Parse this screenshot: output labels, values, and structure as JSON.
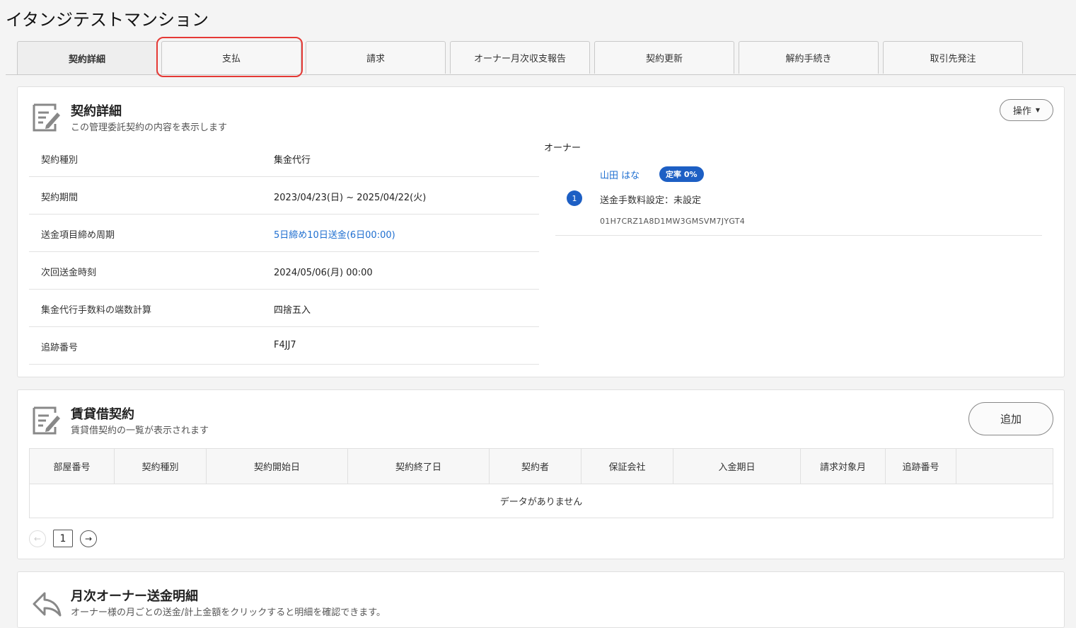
{
  "page": {
    "title": "イタンジテストマンション"
  },
  "tabs": [
    {
      "label": "契約詳細",
      "active": true
    },
    {
      "label": "支払",
      "active": false
    },
    {
      "label": "請求",
      "active": false
    },
    {
      "label": "オーナー月次収支報告",
      "active": false
    },
    {
      "label": "契約更新",
      "active": false
    },
    {
      "label": "解約手続き",
      "active": false
    },
    {
      "label": "取引先発注",
      "active": false
    }
  ],
  "contract": {
    "title": "契約詳細",
    "subtitle": "この管理委託契約の内容を表示します",
    "action_label": "操作",
    "rows": [
      {
        "label": "契約種別",
        "value": "集金代行"
      },
      {
        "label": "契約期間",
        "value": "2023/04/23(日) ~ 2025/04/22(火)"
      },
      {
        "label": "送金項目締め周期",
        "value": "5日締め10日送金(6日00:00)"
      },
      {
        "label": "次回送金時刻",
        "value": "2024/05/06(月) 00:00"
      },
      {
        "label": "集金代行手数料の端数計算",
        "value": "四捨五入"
      },
      {
        "label": "追跡番号",
        "value": "F4JJ7"
      }
    ],
    "owner": {
      "label": "オーナー",
      "name": "山田 はな",
      "badge": "定率 0%",
      "number": "1",
      "fee_setting": "送金手数料設定：未設定",
      "id": "01H7CRZ1A8D1MW3GMSVM7JYGT4"
    }
  },
  "lease": {
    "title": "賃貸借契約",
    "subtitle": "賃貸借契約の一覧が表示されます",
    "add_label": "追加",
    "columns": [
      "部屋番号",
      "契約種別",
      "契約開始日",
      "契約終了日",
      "契約者",
      "保証会社",
      "入金期日",
      "請求対象月",
      "追跡番号",
      ""
    ],
    "empty_message": "データがありません",
    "pager": {
      "prev": "←",
      "page": "1",
      "next": "→"
    }
  },
  "monthly": {
    "title": "月次オーナー送金明細",
    "subtitle": "オーナー様の月ごとの送金/計上金額をクリックすると明細を確認できます。"
  },
  "colors": {
    "accent": "#1d5fc4",
    "link": "#1f6fd0",
    "highlight": "#e53935"
  },
  "icons": {
    "contract": "edit-document-icon",
    "lease": "edit-document-icon",
    "monthly": "reply-arrow-icon",
    "dropdown": "caret-down-icon"
  }
}
